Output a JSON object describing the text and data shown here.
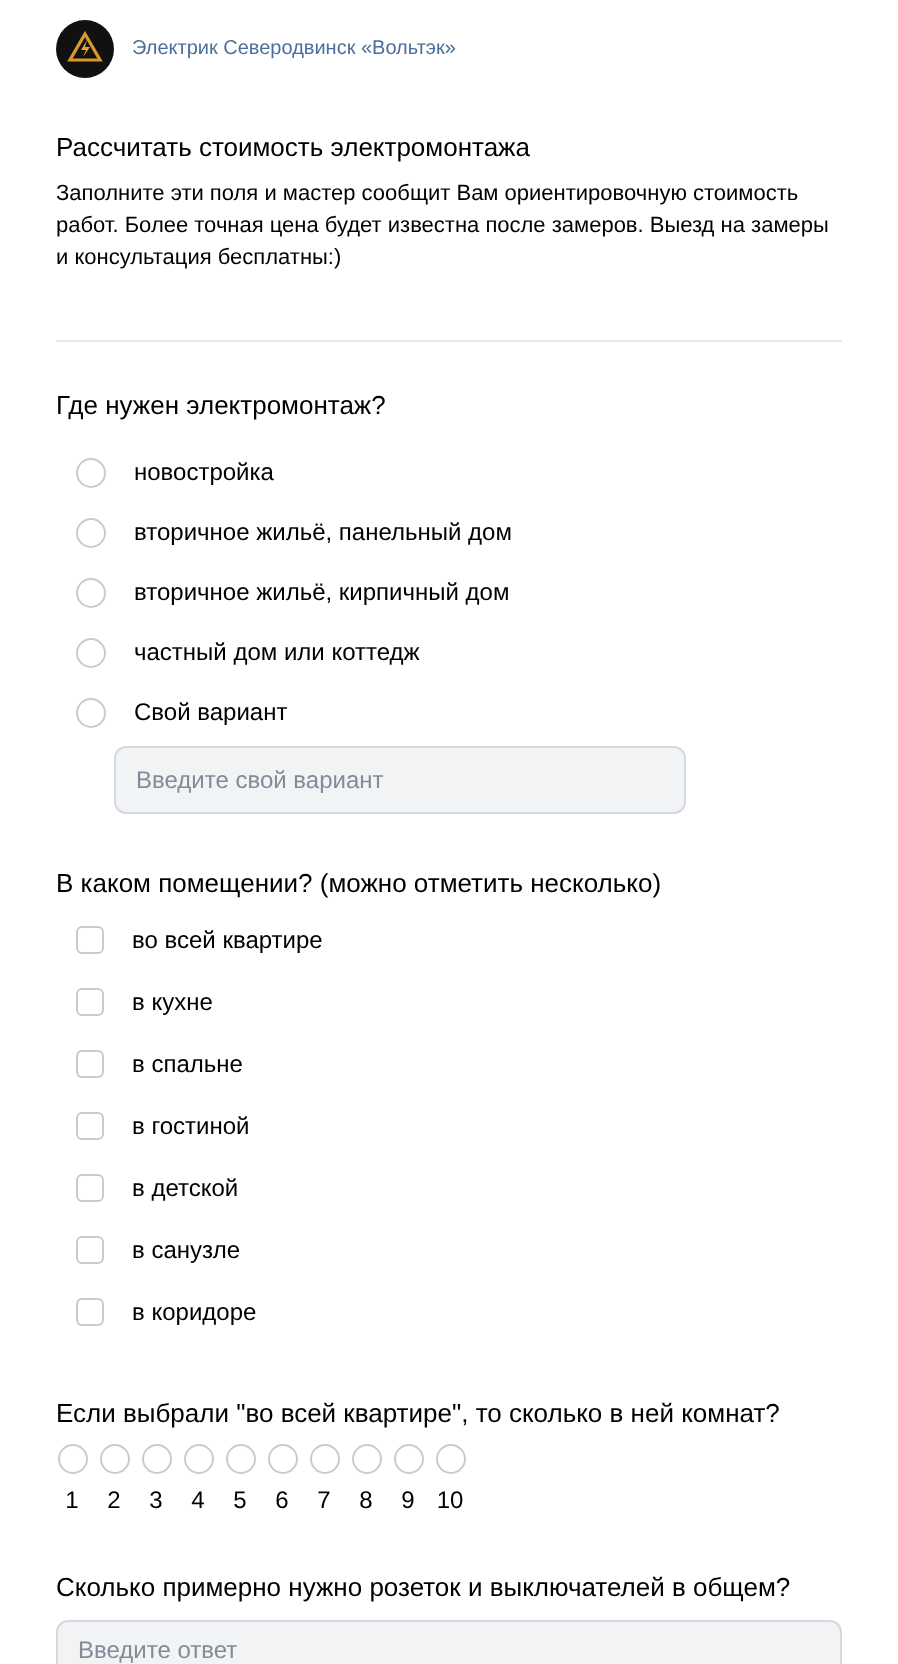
{
  "header": {
    "community_name": "Электрик Северодвинск «Вольтэк»"
  },
  "form": {
    "title": "Рассчитать стоимость электромонтажа",
    "description": "Заполните эти поля и мастер сообщит Вам ориентировочную стоимость работ. Более точная цена будет известна после замеров. Выезд на замеры и консультация бесплатны:)"
  },
  "questions": [
    {
      "kind": "radio",
      "label": "Где нужен электромонтаж?",
      "options": [
        {
          "label": "новостройка",
          "selected": false
        },
        {
          "label": "вторичное жильё, панельный дом",
          "selected": false
        },
        {
          "label": "вторичное жильё, кирпичный дом",
          "selected": false
        },
        {
          "label": "частный дом или коттедж",
          "selected": false
        },
        {
          "label": "Свой вариант",
          "selected": false
        }
      ],
      "other_field": {
        "placeholder": "Введите свой вариант"
      }
    },
    {
      "kind": "checkbox",
      "label": "В каком помещении? (можно отметить несколько)",
      "options": [
        {
          "label": "во всей квартире",
          "checked": false
        },
        {
          "label": "в кухне",
          "checked": false
        },
        {
          "label": "в спальне",
          "checked": false
        },
        {
          "label": "в гостиной",
          "checked": false
        },
        {
          "label": "в детской",
          "checked": false
        },
        {
          "label": "в санузле",
          "checked": false
        },
        {
          "label": "в коридоре",
          "checked": false
        }
      ]
    },
    {
      "kind": "scale",
      "label": "Если выбрали \"во всей квартире\", то сколько в ней комнат?",
      "options": [
        {
          "label": "1",
          "selected": false
        },
        {
          "label": "2",
          "selected": false
        },
        {
          "label": "3",
          "selected": false
        },
        {
          "label": "4",
          "selected": false
        },
        {
          "label": "5",
          "selected": false
        },
        {
          "label": "6",
          "selected": false
        },
        {
          "label": "7",
          "selected": false
        },
        {
          "label": "8",
          "selected": false
        },
        {
          "label": "9",
          "selected": false
        },
        {
          "label": "10",
          "selected": false
        }
      ]
    },
    {
      "kind": "text",
      "label": "Сколько примерно нужно розеток и выключателей в общем?",
      "placeholder": "Введите ответ"
    }
  ]
}
